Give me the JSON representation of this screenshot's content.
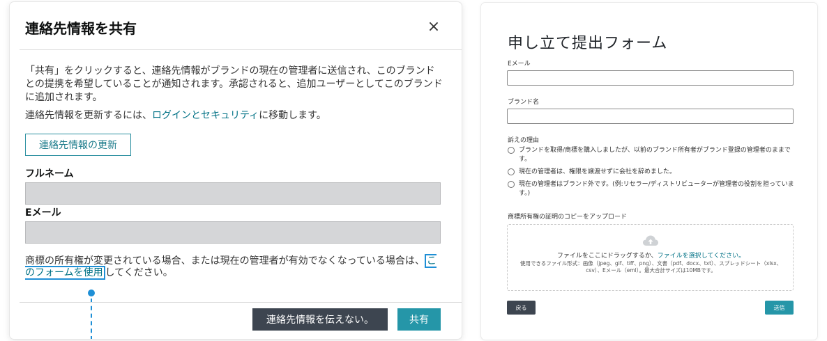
{
  "share_dialog": {
    "title": "連絡先情報を共有",
    "close_icon": "×",
    "description": "「共有」をクリックすると、連絡先情報がブランドの現在の管理者に送信され、このブランドとの提携を希望していることが通知されます。承認されると、追加ユーザーとしてこのブランドに追加されます。",
    "update_prefix": "連絡先情報を更新するには、",
    "update_link": "ログインとセキュリティ",
    "update_suffix": "に移動します。",
    "update_button": "連絡先情報の更新",
    "fullname_label": "フルネーム",
    "fullname_value": "",
    "email_label": "Eメール",
    "email_value": "",
    "notice_prefix": "商標の所有権が変更されている場合、または現在の管理者が有効でなくなっている場合は、",
    "notice_link": "このフォームを使用",
    "notice_suffix": "してください。",
    "decline_button": "連絡先情報を伝えない。",
    "share_button": "共有"
  },
  "claim_form": {
    "title": "申し立て提出フォーム",
    "email_label": "Eメール",
    "email_value": "",
    "brand_label": "ブランド名",
    "brand_value": "",
    "reason_label": "訴えの理由",
    "reasons": [
      "ブランドを取得/商標を購入しましたが、以前のブランド所有者がブランド登録の管理者のままです。",
      "現在の管理者は、権限を譲渡せずに会社を辞めました。",
      "現在の管理者はブランド外です。(例:リセラー/ディストリビューターが管理者の役割を担っています。)"
    ],
    "upload_label": "商標所有権の証明のコピーをアップロード",
    "upload_icon": "cloud-upload-icon",
    "drop_prefix": "ファイルをここにドラッグするか、",
    "drop_link": "ファイルを選択してください。",
    "accepted_formats": "使用できるファイル形式：画像（jpeg、gif、tiff、png）、文書（pdf、docx、txt）、スプレッドシート（xlsx、csv）、Eメール（eml）。最大合計サイズは10MBです。",
    "back_button": "戻る",
    "submit_button": "送信"
  },
  "colors": {
    "link": "#007185",
    "accent_teal": "#2596a8",
    "dark_button": "#3d4550",
    "highlight_blue": "#1e8fd6"
  }
}
